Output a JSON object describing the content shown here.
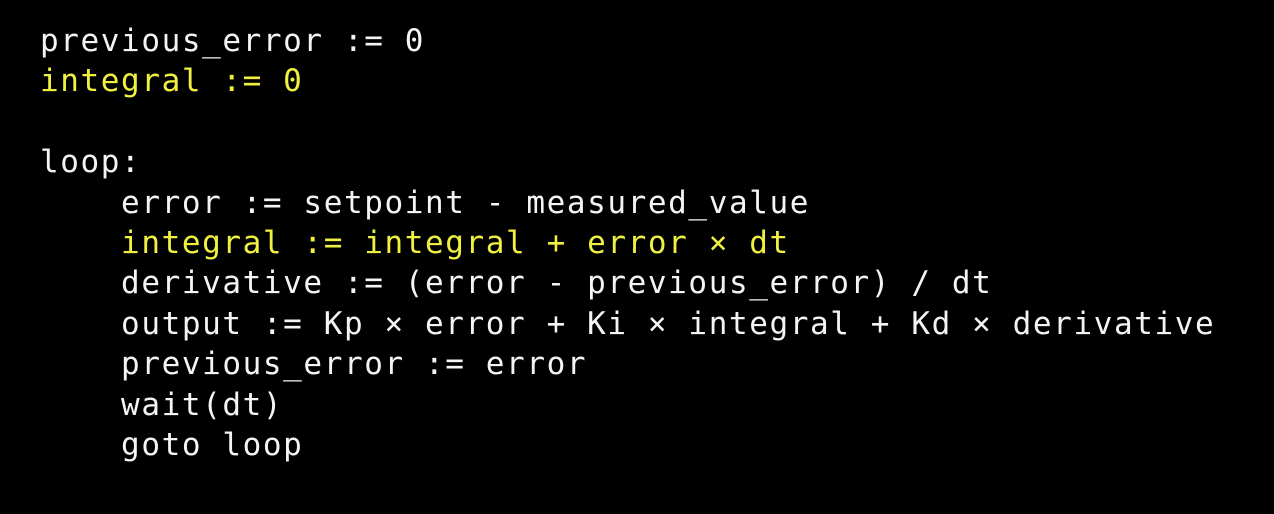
{
  "colors": {
    "text": "#f4f4f4",
    "highlight": "#f0f040",
    "background": "#000000"
  },
  "code_lines": [
    {
      "text": "previous_error := 0",
      "highlighted": false
    },
    {
      "text": "integral := 0",
      "highlighted": true
    },
    {
      "text": "",
      "highlighted": false
    },
    {
      "text": "loop:",
      "highlighted": false
    },
    {
      "text": "    error := setpoint - measured_value",
      "highlighted": false
    },
    {
      "text": "    integral := integral + error × dt",
      "highlighted": true
    },
    {
      "text": "    derivative := (error - previous_error) / dt",
      "highlighted": false
    },
    {
      "text": "    output := Kp × error + Ki × integral + Kd × derivative",
      "highlighted": false
    },
    {
      "text": "    previous_error := error",
      "highlighted": false
    },
    {
      "text": "    wait(dt)",
      "highlighted": false
    },
    {
      "text": "    goto loop",
      "highlighted": false
    }
  ]
}
